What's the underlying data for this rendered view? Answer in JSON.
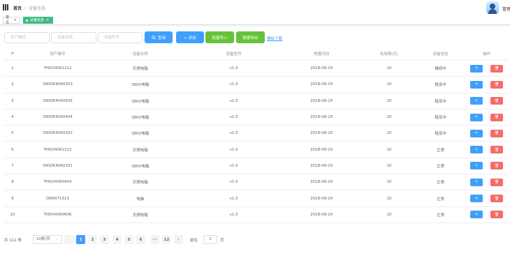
{
  "nav": {
    "breadcrumb_home": "首页",
    "breadcrumb_separator": "/",
    "breadcrumb_current": "设备信息",
    "username": "管理"
  },
  "tags": {
    "home_label": "首页",
    "active_label": "设备信息",
    "close_glyph": "×"
  },
  "filters": {
    "asset_placeholder": "资产编码",
    "name_placeholder": "设备名称",
    "model_placeholder": "设备型号",
    "search_label": "查询",
    "add_label": "+ 添加",
    "import_label": "批量导入",
    "export_label": "数据导出",
    "template_label": "模板下载"
  },
  "table": {
    "headers": [
      "#",
      "资产编号",
      "设备名称",
      "设备型号",
      "购置时间",
      "有效期(月)",
      "设备状态",
      "操作"
    ],
    "rows": [
      [
        "1",
        "THDX4061212",
        "天燃电箱",
        "v1.0",
        "2018-08-29",
        "10",
        "维修中"
      ],
      [
        "2",
        "380DK4060303",
        "380V电箱",
        "v1.0",
        "2018-08-29",
        "10",
        "租赁中"
      ],
      [
        "3",
        "380DK4060505",
        "380V电箱",
        "v1.0",
        "2018-08-29",
        "10",
        "租赁中"
      ],
      [
        "4",
        "380DK4060404",
        "380V电箱",
        "v1.0",
        "2018-08-29",
        "10",
        "租赁中"
      ],
      [
        "5",
        "380DK4060202",
        "380V电箱",
        "v1.0",
        "2018-08-29",
        "10",
        "租赁中"
      ],
      [
        "6",
        "THDX4061313",
        "天燃电箱",
        "v1.0",
        "2018-08-29",
        "10",
        "正常"
      ],
      [
        "7",
        "380DK4060101",
        "380V电箱",
        "v1.0",
        "2018-08-29",
        "10",
        "正常"
      ],
      [
        "8",
        "THDX4060404",
        "天燃电箱",
        "v1.0",
        "2018-08-29",
        "10",
        "正常"
      ],
      [
        "9",
        "DN4071313",
        "电脑",
        "v1.0",
        "2018-08-29",
        "10",
        "正常"
      ],
      [
        "10",
        "THDX4060606",
        "天燃电箱",
        "v1.0",
        "2018-08-29",
        "10",
        "正常"
      ]
    ],
    "edit_glyph": "✎",
    "delete_glyph": "🗑"
  },
  "pagination": {
    "total_text": "共 112 条",
    "page_size": "10条/页",
    "pages": [
      "1",
      "2",
      "3",
      "4",
      "5",
      "6",
      "···",
      "12"
    ],
    "active_page": "1",
    "prev_glyph": "‹",
    "next_glyph": "›",
    "goto_prefix": "前往",
    "goto_value": "1",
    "goto_suffix": "页"
  },
  "colors": {
    "primary": "#409eff",
    "success": "#67c23a",
    "danger": "#f56c6c",
    "tag_active": "#42b983"
  }
}
